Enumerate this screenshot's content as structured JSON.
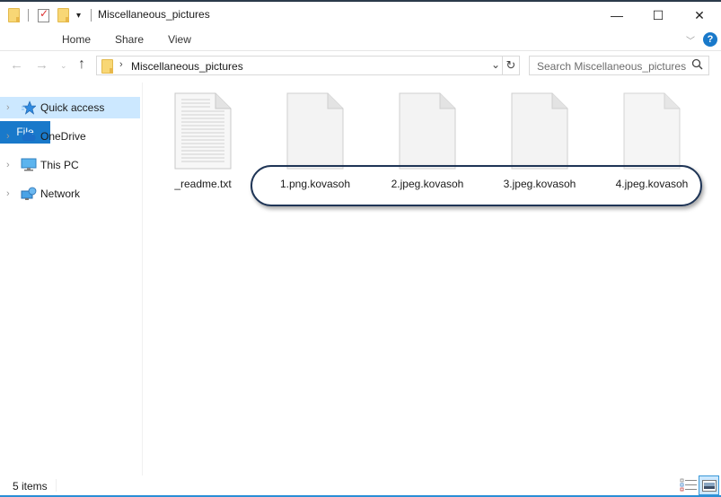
{
  "window": {
    "title": "Miscellaneous_pictures",
    "controls": {
      "minimize": "—",
      "maximize": "☐",
      "close": "✕"
    }
  },
  "quick_access_toolbar": {
    "icons": [
      "folder-icon",
      "properties-icon",
      "new-folder-icon"
    ],
    "dropdown": "▾"
  },
  "ribbon": {
    "tabs": [
      {
        "label": "File",
        "active": true
      },
      {
        "label": "Home"
      },
      {
        "label": "Share"
      },
      {
        "label": "View"
      }
    ],
    "expand_icon": "﹀",
    "help_icon": "?"
  },
  "navigation": {
    "back": "←",
    "forward": "→",
    "recent": "⌄",
    "up": "↑",
    "address": {
      "separator": "›",
      "path": "Miscellaneous_pictures",
      "dropdown": "⌄"
    },
    "refresh": "↻",
    "search": {
      "placeholder": "Search Miscellaneous_pictures",
      "icon": "⚲"
    }
  },
  "sidebar": {
    "items": [
      {
        "label": "Quick access",
        "icon": "star-icon",
        "selected": true
      },
      {
        "label": "OneDrive",
        "icon": "cloud-icon"
      },
      {
        "label": "This PC",
        "icon": "computer-icon"
      },
      {
        "label": "Network",
        "icon": "network-icon"
      }
    ]
  },
  "files": [
    {
      "name": "_readme.txt",
      "type": "text"
    },
    {
      "name": "1.png.kovasoh",
      "type": "unknown"
    },
    {
      "name": "2.jpeg.kovasoh",
      "type": "unknown"
    },
    {
      "name": "3.jpeg.kovasoh",
      "type": "unknown"
    },
    {
      "name": "4.jpeg.kovasoh",
      "type": "unknown"
    }
  ],
  "status_bar": {
    "item_count": "5 items"
  },
  "colors": {
    "accent": "#1979ca",
    "selection": "#cce8ff",
    "highlight_outline": "#1f3556"
  }
}
